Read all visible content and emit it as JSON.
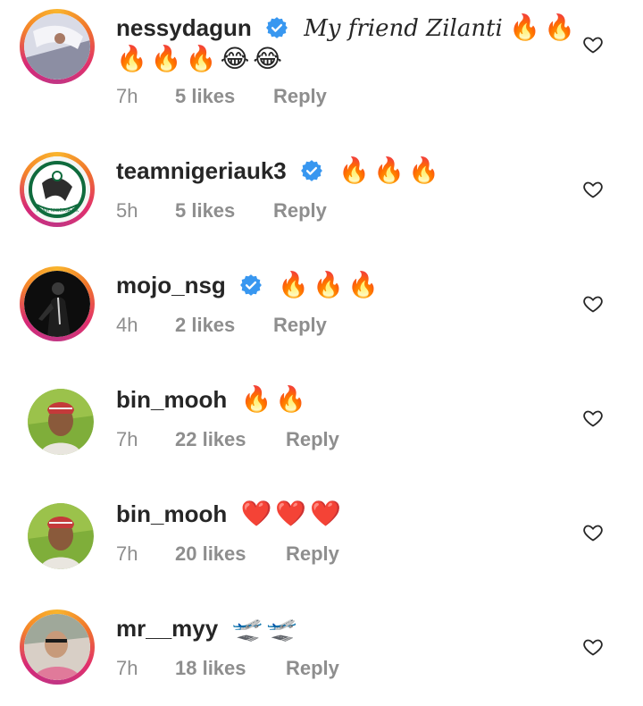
{
  "comments": [
    {
      "username": "nessydagun",
      "verified": true,
      "text": "My friend Zilanti",
      "emoji_line1": "🔥🔥",
      "emoji_line2": "🔥🔥🔥😂😂",
      "time": "7h",
      "likes": "5 likes",
      "reply": "Reply"
    },
    {
      "username": "teamnigeriauk3",
      "verified": true,
      "text": "",
      "emoji_line1": "🔥🔥🔥",
      "time": "5h",
      "likes": "5 likes",
      "reply": "Reply",
      "avatar_text": "TEAM NIGERIA UK"
    },
    {
      "username": "mojo_nsg",
      "verified": true,
      "text": "",
      "emoji_line1": "🔥🔥🔥",
      "time": "4h",
      "likes": "2 likes",
      "reply": "Reply"
    },
    {
      "username": "bin_mooh",
      "verified": false,
      "text": "",
      "emoji_line1": "🔥🔥",
      "time": "7h",
      "likes": "22 likes",
      "reply": "Reply"
    },
    {
      "username": "bin_mooh",
      "verified": false,
      "text": "",
      "emoji_line1": "❤️❤️❤️",
      "time": "7h",
      "likes": "20 likes",
      "reply": "Reply"
    },
    {
      "username": "mr__myy",
      "verified": false,
      "text": "",
      "emoji_line1": "🛫🛫",
      "time": "7h",
      "likes": "18 likes",
      "reply": "Reply"
    }
  ],
  "colors": {
    "text": "#262626",
    "meta": "#8e8e8e",
    "verified": "#3897f0",
    "fire": "#f5820d"
  },
  "icons": [
    "verified-badge-icon",
    "heart-outline-icon"
  ]
}
